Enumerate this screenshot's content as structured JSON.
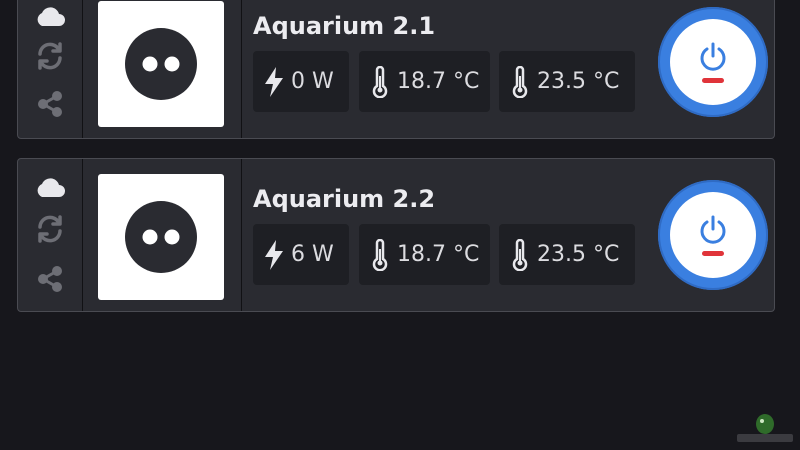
{
  "devices": [
    {
      "name": "Aquarium 2.1",
      "power": "0 W",
      "temp1": "18.7 °C",
      "temp2": "23.5 °C",
      "status_color": "#e0343a"
    },
    {
      "name": "Aquarium 2.2",
      "power": "6 W",
      "temp1": "18.7 °C",
      "temp2": "23.5 °C",
      "status_color": "#e0343a"
    }
  ],
  "icons": {
    "cloud": "cloud-icon",
    "sync": "sync-icon",
    "share": "share-icon",
    "outlet": "power-outlet-icon",
    "bolt": "lightning-bolt-icon",
    "thermometer": "thermometer-icon",
    "power": "power-icon"
  },
  "colors": {
    "accent": "#3a7fe0",
    "card_bg": "#2a2b31",
    "page_bg": "#17171c",
    "chip_bg": "#1e1f24"
  }
}
